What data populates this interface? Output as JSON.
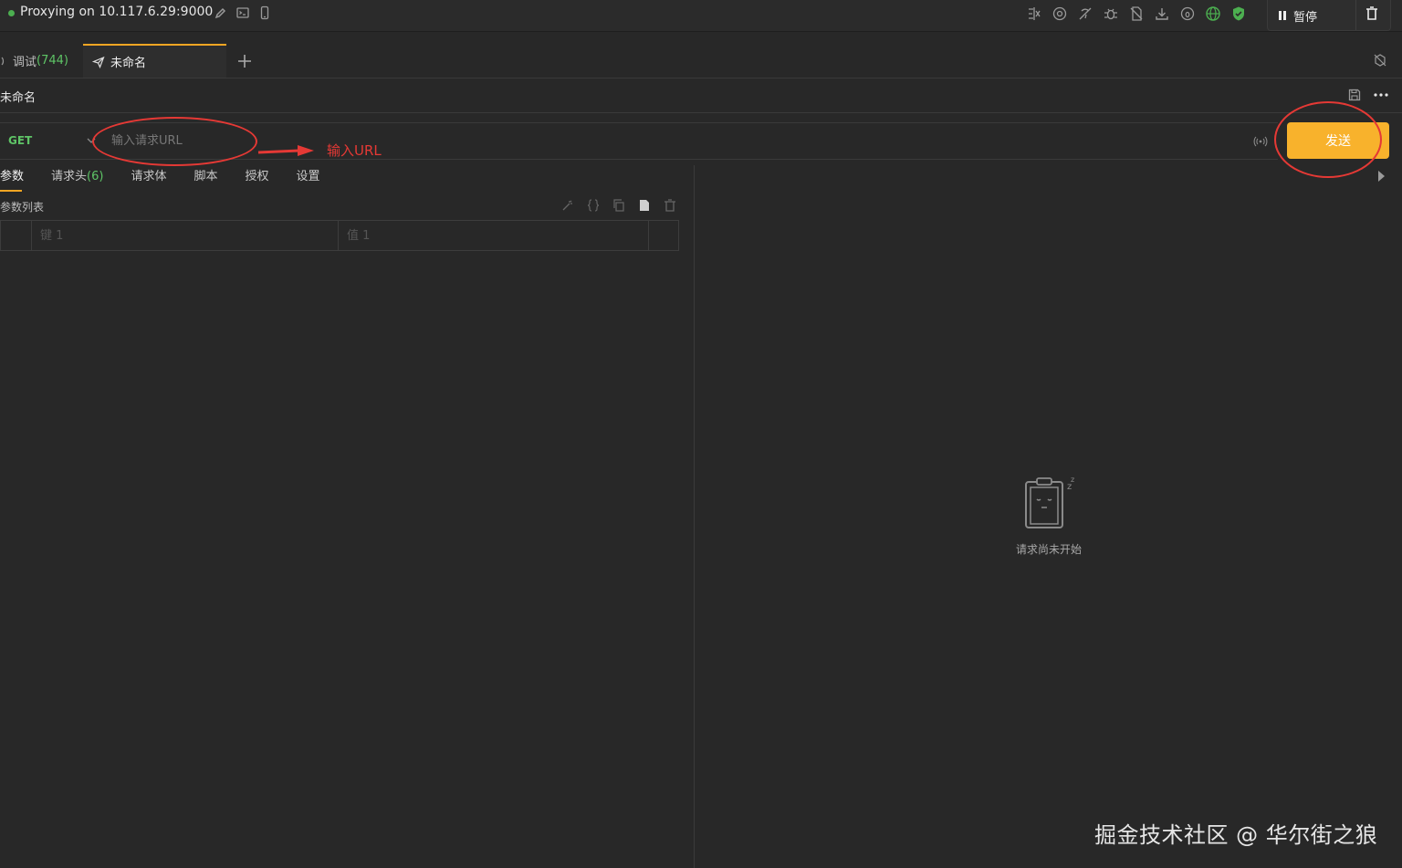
{
  "topbar": {
    "proxy_status": "Proxying on 10.117.6.29:9000",
    "pause_label": "暂停",
    "icons": [
      "edit-icon",
      "terminal-icon",
      "mobile-icon",
      "filter-icon",
      "at-icon",
      "no-network-icon",
      "bug-icon",
      "no-cache-icon",
      "download-icon",
      "sequence-icon",
      "globe-icon",
      "shield-icon"
    ],
    "accent_green": "#4caf50"
  },
  "tabs": {
    "debug_label": "调试",
    "debug_count": "(744)",
    "current_label": "未命名"
  },
  "request": {
    "title": "未命名",
    "method": "GET",
    "url_placeholder": "输入请求URL",
    "send_label": "发送"
  },
  "annotation": {
    "label": "输入URL",
    "color": "#e53935"
  },
  "subtabs": {
    "params": "参数",
    "headers": "请求头",
    "headers_count": "(6)",
    "body": "请求体",
    "script": "脚本",
    "auth": "授权",
    "settings": "设置"
  },
  "params": {
    "list_label": "参数列表",
    "key_placeholder": "键 1",
    "value_placeholder": "值 1"
  },
  "response": {
    "empty_text": "请求尚未开始"
  },
  "watermark": "掘金技术社区 @ 华尔街之狼",
  "colors": {
    "accent": "#f5a623",
    "send_button": "#f8b22c",
    "method_green": "#5ec466",
    "background": "#282828"
  }
}
